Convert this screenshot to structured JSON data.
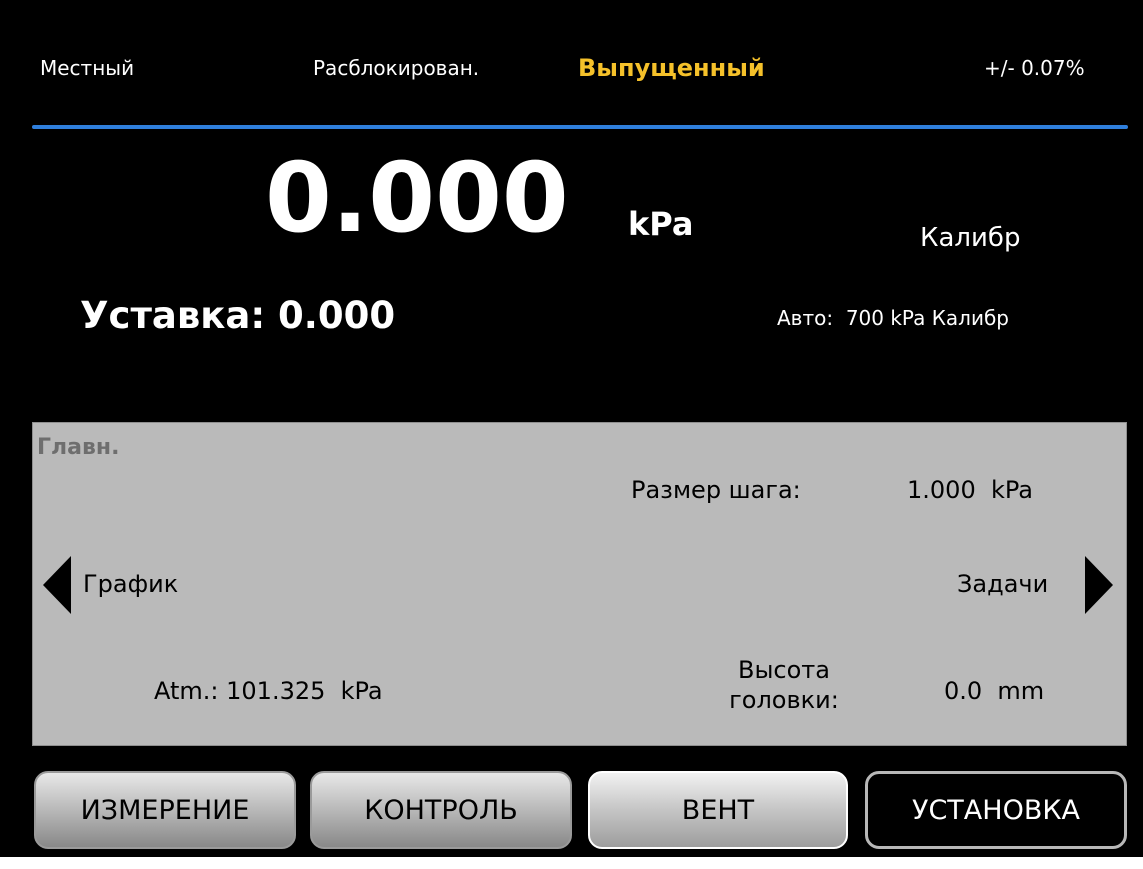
{
  "status_bar": {
    "mode": "Местный",
    "lock_state": "Расблокирован.",
    "vent_state": "Выпущенный",
    "accuracy": "+/- 0.07%"
  },
  "colors": {
    "accent_divider": "#2f7fdc",
    "vent_state_text": "#f5c12a",
    "panel_bg": "#bababa"
  },
  "main": {
    "reading_value": "0.000",
    "reading_unit": "kPa",
    "measurement_mode": "Калибр",
    "setpoint_text": "Уставка: 0.000",
    "range_label": "Авто:",
    "range_value": "700 kPa Калибр"
  },
  "panel": {
    "title": "Главн.",
    "step_size_label": "Размер шага:",
    "step_size_value": "1.000  kPa",
    "nav_left_label": "График",
    "nav_right_label": "Задачи",
    "atm_text": "Atm.: 101.325  kPa",
    "head_height_label": "Высота головки:",
    "head_height_value": "0.0  mm",
    "icons": {
      "left": "triangle-left-icon",
      "right": "triangle-right-icon"
    }
  },
  "buttons": {
    "measure": "ИЗМЕРЕНИЕ",
    "control": "КОНТРОЛЬ",
    "vent": "ВЕНТ",
    "setup": "УСТАНОВКА"
  }
}
